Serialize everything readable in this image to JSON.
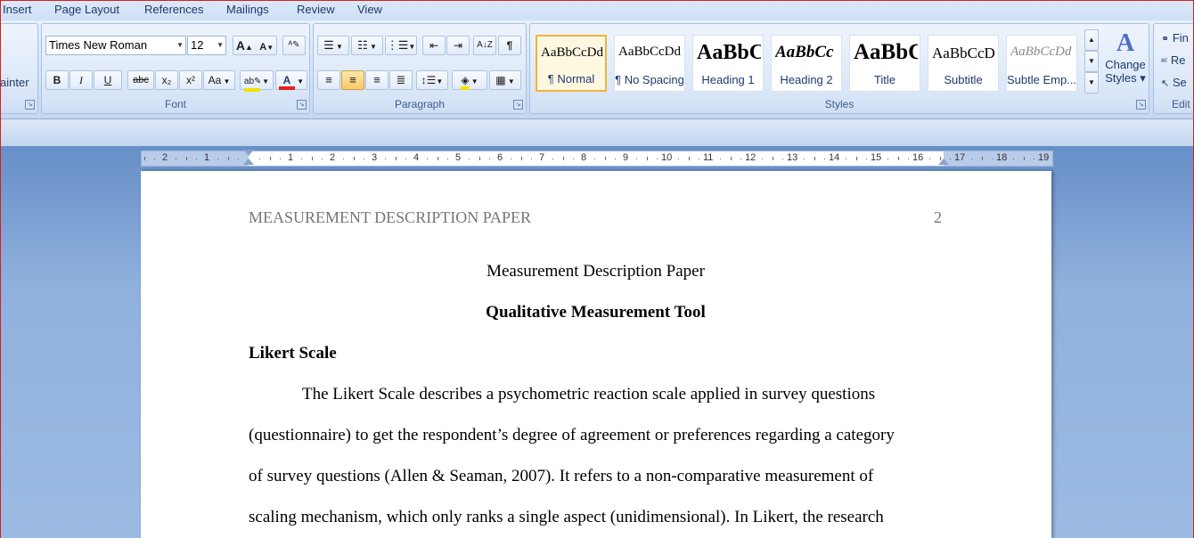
{
  "tabs": [
    "Insert",
    "Page Layout",
    "References",
    "Mailings",
    "Review",
    "View"
  ],
  "clipboard": {
    "painter_label": "ainter"
  },
  "font": {
    "family": "Times New Roman",
    "size": "12",
    "group_label": "Font",
    "grow": "A",
    "shrink": "A",
    "bold": "B",
    "italic": "I",
    "underline": "U",
    "strike": "abc",
    "sub": "x₂",
    "sup": "x²",
    "case": "Aa",
    "highlight_color": "#f4e200",
    "font_color": "#e02020"
  },
  "paragraph": {
    "group_label": "Paragraph",
    "pilcrow": "¶"
  },
  "styles": {
    "group_label": "Styles",
    "items": [
      {
        "preview": "AaBbCcDd",
        "name": "¶ Normal"
      },
      {
        "preview": "AaBbCcDd",
        "name": "¶ No Spacing"
      },
      {
        "preview": "AaBbC",
        "name": "Heading 1"
      },
      {
        "preview": "AaBbCc",
        "name": "Heading 2"
      },
      {
        "preview": "AaBbC",
        "name": "Title"
      },
      {
        "preview": "AaBbCcD",
        "name": "Subtitle"
      },
      {
        "preview": "AaBbCcDd",
        "name": "Subtle Emp..."
      }
    ],
    "change_styles_line1": "Change",
    "change_styles_line2": "Styles ▾"
  },
  "editing": {
    "group_label": "Edit",
    "find": "Fin",
    "replace": "Re",
    "select": "Se"
  },
  "ruler": {
    "numbers": [
      "2",
      "1",
      "1",
      "2",
      "3",
      "4",
      "5",
      "6",
      "7",
      "8",
      "9",
      "10",
      "11",
      "12",
      "13",
      "14",
      "15",
      "16",
      "17",
      "18",
      "19"
    ]
  },
  "document": {
    "header_left": "MEASUREMENT DESCRIPTION PAPER",
    "page_number": "2",
    "title": "Measurement Description Paper",
    "subtitle": "Qualitative Measurement Tool",
    "heading": "Likert Scale",
    "lines": [
      "The Likert Scale describes a psychometric reaction scale applied in survey questions",
      "(questionnaire) to get the respondent’s degree of agreement or preferences regarding a category",
      "of survey questions (Allen & Seaman, 2007). It refers to a non-comparative measurement of",
      "scaling mechanism, which only ranks a single aspect (unidimensional). In Likert, the research"
    ]
  }
}
